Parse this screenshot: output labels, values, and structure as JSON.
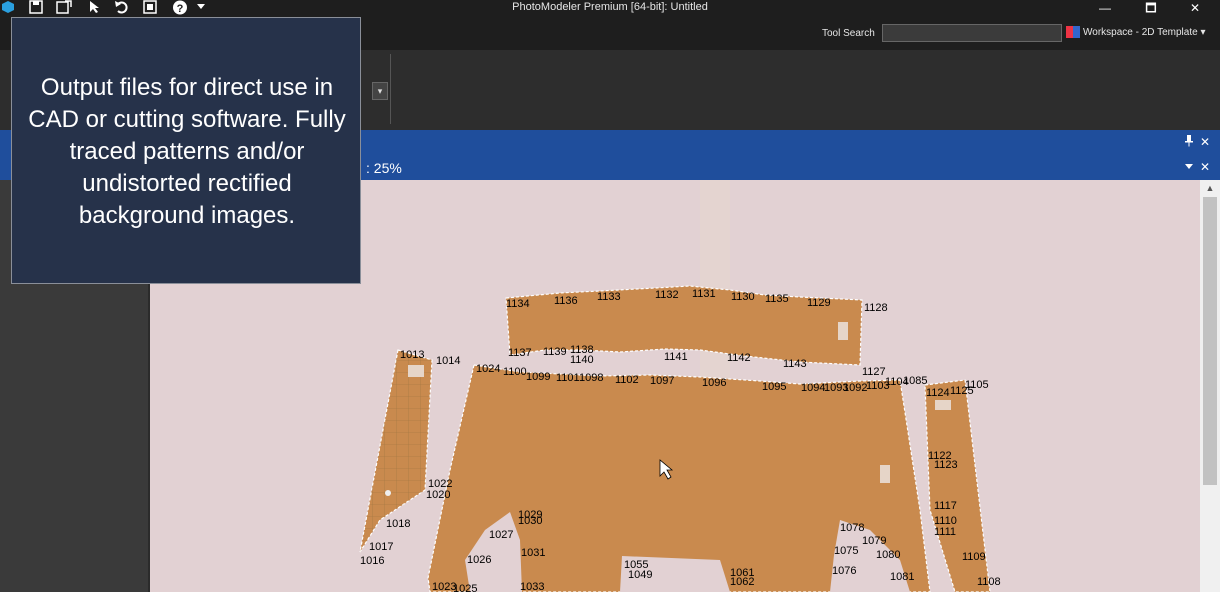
{
  "window": {
    "title": "PhotoModeler Premium [64-bit]: Untitled",
    "minimize": "—",
    "maximize": "🗖",
    "close": "✕"
  },
  "quick_access": [
    "save-icon",
    "save-as-icon",
    "pointer-icon",
    "undo-icon",
    "layout-icon",
    "help-icon",
    "chevron-down-icon"
  ],
  "toolbar": {
    "tool_search_label": "Tool Search",
    "tool_search_value": "",
    "workspace_label": "Workspace - 2D Template"
  },
  "document": {
    "zoom_label": ": 25%",
    "pin": "🖈",
    "close": "✕",
    "dropdown": "▾"
  },
  "tooltip": {
    "text": "Output files for direct use in CAD or cutting software. Fully traced patterns and/or undistorted rectified background images."
  },
  "colors": {
    "title_bar": "#1e1e1e",
    "doc_header": "#1f4e9c",
    "tooltip_bg": "#26324a",
    "pattern_fill": "#c98a4e",
    "photo_bg": "#e0cfd1"
  },
  "point_labels": {
    "p1134": "1134",
    "p1136": "1136",
    "p1133": "1133",
    "p1132": "1132",
    "p1131": "1131",
    "p1130": "1130",
    "p1135": "1135",
    "p1129": "1129",
    "p1128": "1128",
    "p1137": "1137",
    "p1139": "1139",
    "p1138": "1138",
    "p1140": "1140",
    "p1141": "1141",
    "p1142": "1142",
    "p1143": "1143",
    "p1127": "1127",
    "p1013": "1013",
    "p1014": "1014",
    "p1024": "1024",
    "p1100": "1100",
    "p1099": "1099",
    "p1101": "1101",
    "p1098": "1098",
    "p1102": "1102",
    "p1097": "1097",
    "p1096": "1096",
    "p1095": "1095",
    "p1094": "1094",
    "p1093": "1093",
    "p1092": "1092",
    "p1103": "1103",
    "p1104": "1104",
    "p1085": "1085",
    "p1124": "1124",
    "p1125": "1125",
    "p1105": "1105",
    "p1122": "1122",
    "p1123": "1123",
    "p1117": "1117",
    "p1110": "1110",
    "p1111": "1111",
    "p1109": "1109",
    "p1108": "1108",
    "p1022": "1022",
    "p1020": "1020",
    "p1018": "1018",
    "p1017": "1017",
    "p1016": "1016",
    "p1029": "1029",
    "p1030": "1030",
    "p1027": "1027",
    "p1031": "1031",
    "p1026": "1026",
    "p1023": "1023",
    "p1025": "1025",
    "p1033": "1033",
    "p1055": "1055",
    "p1049": "1049",
    "p1061": "1061",
    "p1062": "1062",
    "p1078": "1078",
    "p1079": "1079",
    "p1075": "1075",
    "p1080": "1080",
    "p1076": "1076",
    "p1081": "1081"
  }
}
